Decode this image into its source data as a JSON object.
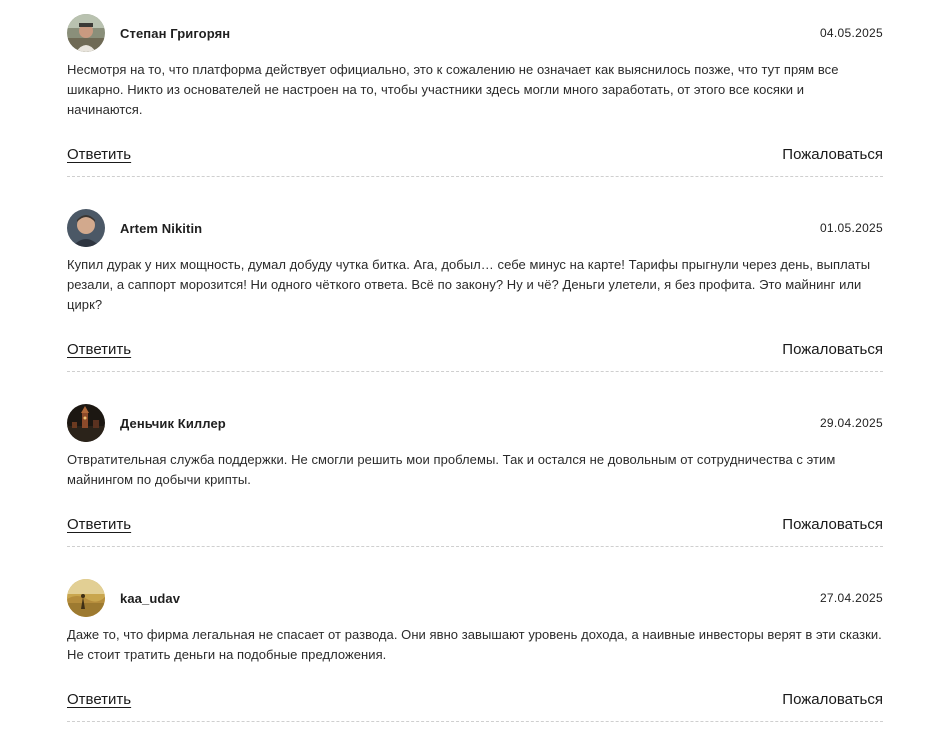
{
  "comments": [
    {
      "author": "Степан Григорян",
      "date": "04.05.2025",
      "avatar": "avatar-photo-man-outdoors",
      "text": "Несмотря на то, что платформа действует официально, это к сожалению не означает как выяснилось позже, что тут прям все шикарно. Никто из основателей не настроен на то, чтобы участники здесь могли много заработать, от этого все косяки и начинаются.",
      "reply_label": "Ответить",
      "report_label": "Пожаловаться"
    },
    {
      "author": "Artem Nikitin",
      "date": "01.05.2025",
      "avatar": "avatar-photo-man-portrait",
      "text": "Купил дурак у них мощность, думал добуду чутка битка. Ага, добыл… себе минус на карте! Тарифы прыгнули через день, выплаты резали, а саппорт морозится! Ни одного чёткого ответа. Всё по закону? Ну и чё? Деньги улетели, я без профита. Это майнинг или цирк?",
      "reply_label": "Ответить",
      "report_label": "Пожаловаться"
    },
    {
      "author": "Деньчик Киллер",
      "date": "29.04.2025",
      "avatar": "avatar-photo-night-city",
      "text": "Отвратительная служба поддержки. Не смогли решить мои проблемы. Так и остался не довольным от сотрудничества с этим майнингом по добычи крипты.",
      "reply_label": "Ответить",
      "report_label": "Пожаловаться"
    },
    {
      "author": "kaa_udav",
      "date": "27.04.2025",
      "avatar": "avatar-photo-golden-field",
      "text": "Даже то, что фирма легальная не спасает от развода. Они явно завышают уровень дохода, а наивные инвесторы верят в эти сказки. Не стоит тратить деньги на подобные предложения.",
      "reply_label": "Ответить",
      "report_label": "Пожаловаться"
    }
  ]
}
